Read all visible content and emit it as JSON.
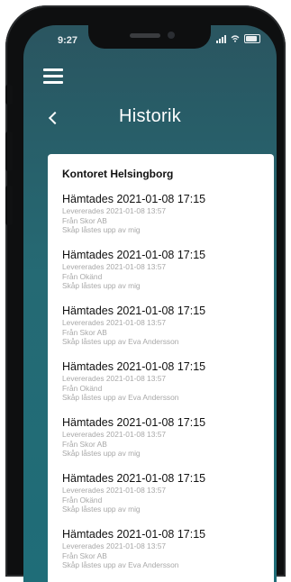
{
  "status_bar": {
    "time": "9:27"
  },
  "header": {
    "title": "Historik"
  },
  "card": {
    "title": "Kontoret Helsingborg",
    "entries": [
      {
        "picked": "Hämtades 2021-01-08 17:15",
        "delivered": "Levererades 2021-01-08 13:57",
        "from": "Från Skor AB",
        "unlocked": "Skåp låstes upp av mig"
      },
      {
        "picked": "Hämtades 2021-01-08 17:15",
        "delivered": "Levererades 2021-01-08 13:57",
        "from": "Från Okänd",
        "unlocked": "Skåp låstes upp av mig"
      },
      {
        "picked": "Hämtades 2021-01-08 17:15",
        "delivered": "Levererades 2021-01-08 13:57",
        "from": "Från Skor AB",
        "unlocked": "Skåp låstes upp av Eva Andersson"
      },
      {
        "picked": "Hämtades 2021-01-08 17:15",
        "delivered": "Levererades 2021-01-08 13:57",
        "from": "Från Okänd",
        "unlocked": "Skåp låstes upp av Eva Andersson"
      },
      {
        "picked": "Hämtades 2021-01-08 17:15",
        "delivered": "Levererades 2021-01-08 13:57",
        "from": "Från Skor AB",
        "unlocked": "Skåp låstes upp av mig"
      },
      {
        "picked": "Hämtades 2021-01-08 17:15",
        "delivered": "Levererades 2021-01-08 13:57",
        "from": "Från Okänd",
        "unlocked": "Skåp låstes upp av mig"
      },
      {
        "picked": "Hämtades 2021-01-08 17:15",
        "delivered": "Levererades 2021-01-08 13:57",
        "from": "Från Skor AB",
        "unlocked": "Skåp låstes upp av Eva Andersson"
      }
    ]
  },
  "colors": {
    "header_bg": "#256a74",
    "card_bg": "#ffffff",
    "primary_text": "#111111",
    "secondary_text": "#a8a8a8"
  }
}
